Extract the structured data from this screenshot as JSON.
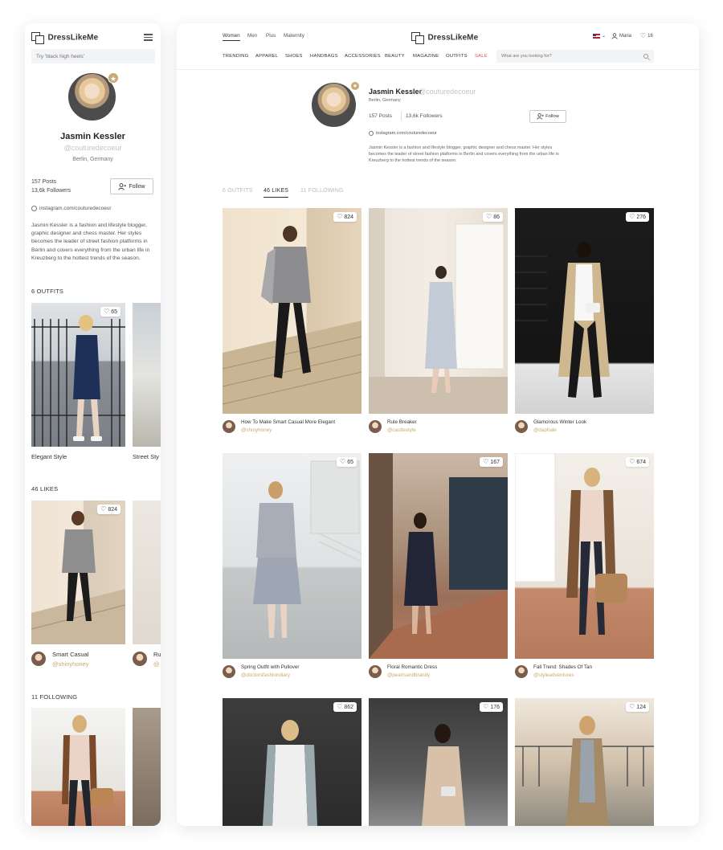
{
  "brand": {
    "name": "DressLikeMe"
  },
  "mobile": {
    "search_placeholder": "Try 'black high heels'",
    "profile": {
      "name": "Jasmin Kessler",
      "handle": "@couturedecoeur",
      "location": "Berlin, Germany",
      "posts": "157 Posts",
      "followers": "13,6k Followers",
      "follow_label": "Follow",
      "instagram": "instagram.com/couturedecoeur",
      "bio": "Jasmin Kessler is a fashion and lifestyle blogger, graphic designer and chess master. Her styles becomes the leader of street fashion platforms in Berlin and covers everything from the urban life in Kreuzberg to the hottest trends of the season."
    },
    "sections": {
      "outfits": "6 OUTFITS",
      "likes": "46 LIKES",
      "following": "11 FOLLOWING"
    },
    "outfit_cards": [
      {
        "title": "Elegant Style",
        "likes": "65"
      },
      {
        "title": "Street Sty"
      }
    ],
    "like_cards": [
      {
        "title": "Smart Casual",
        "user": "@shinyhoney",
        "likes": "824"
      },
      {
        "title": "Ru",
        "user": "@"
      }
    ]
  },
  "desktop": {
    "gender_tabs": [
      "Women",
      "Men",
      "Plus",
      "Maternity"
    ],
    "user_name": "Maria",
    "favorites_count": "16",
    "nav": [
      "TRENDING",
      "APPAREL",
      "SHOES",
      "HANDBAGS",
      "ACCESSORIES",
      "BEAUTY",
      "MAGAZINE",
      "OUTFITS",
      "SALE"
    ],
    "search_placeholder": "What are you looking for?",
    "profile": {
      "name": "Jasmin Kessler",
      "handle": "@couturedecoeur",
      "location": "Berlin, Germany",
      "posts": "157 Posts",
      "followers": "13,6k Followers",
      "follow_label": "Follow",
      "instagram": "instagram.com/couturedecoeur",
      "bio": "Jasmin Kessler is a fashion and lifestyle blogger, graphic designer and chess master. Her styles becomes the leader of street fashion platforms in Berlin and covers everything from the urban life in Kreuzberg to the hottest trends of the season."
    },
    "tabs": [
      "6 OUTFITS",
      "46 LIKES",
      "11 FOLLOWING"
    ],
    "cards": [
      {
        "title": "How To Make Smart Casual More Elegant",
        "user": "@shinyhoney",
        "likes": "824"
      },
      {
        "title": "Rule Breaker",
        "user": "@castlestyle",
        "likes": "86"
      },
      {
        "title": "Glamorous Winter Look",
        "user": "@daphale",
        "likes": "276"
      },
      {
        "title": "Spring Outfit with Pullover",
        "user": "@doctorsfashiondiary",
        "likes": "65"
      },
      {
        "title": "Floral Romantic Dress",
        "user": "@pearlsandbrandy",
        "likes": "167"
      },
      {
        "title": "Fall Trend: Shades Of Tan",
        "user": "@styleadventures",
        "likes": "674"
      },
      {
        "likes": "862"
      },
      {
        "likes": "176"
      },
      {
        "likes": "124"
      }
    ]
  },
  "icons": {
    "heart": "♡",
    "star": "★",
    "add_user": "person-plus"
  },
  "colors": {
    "accent_gold": "#c9a96e",
    "sale_red": "#e0523f",
    "muted_text": "#c4c4c4"
  }
}
